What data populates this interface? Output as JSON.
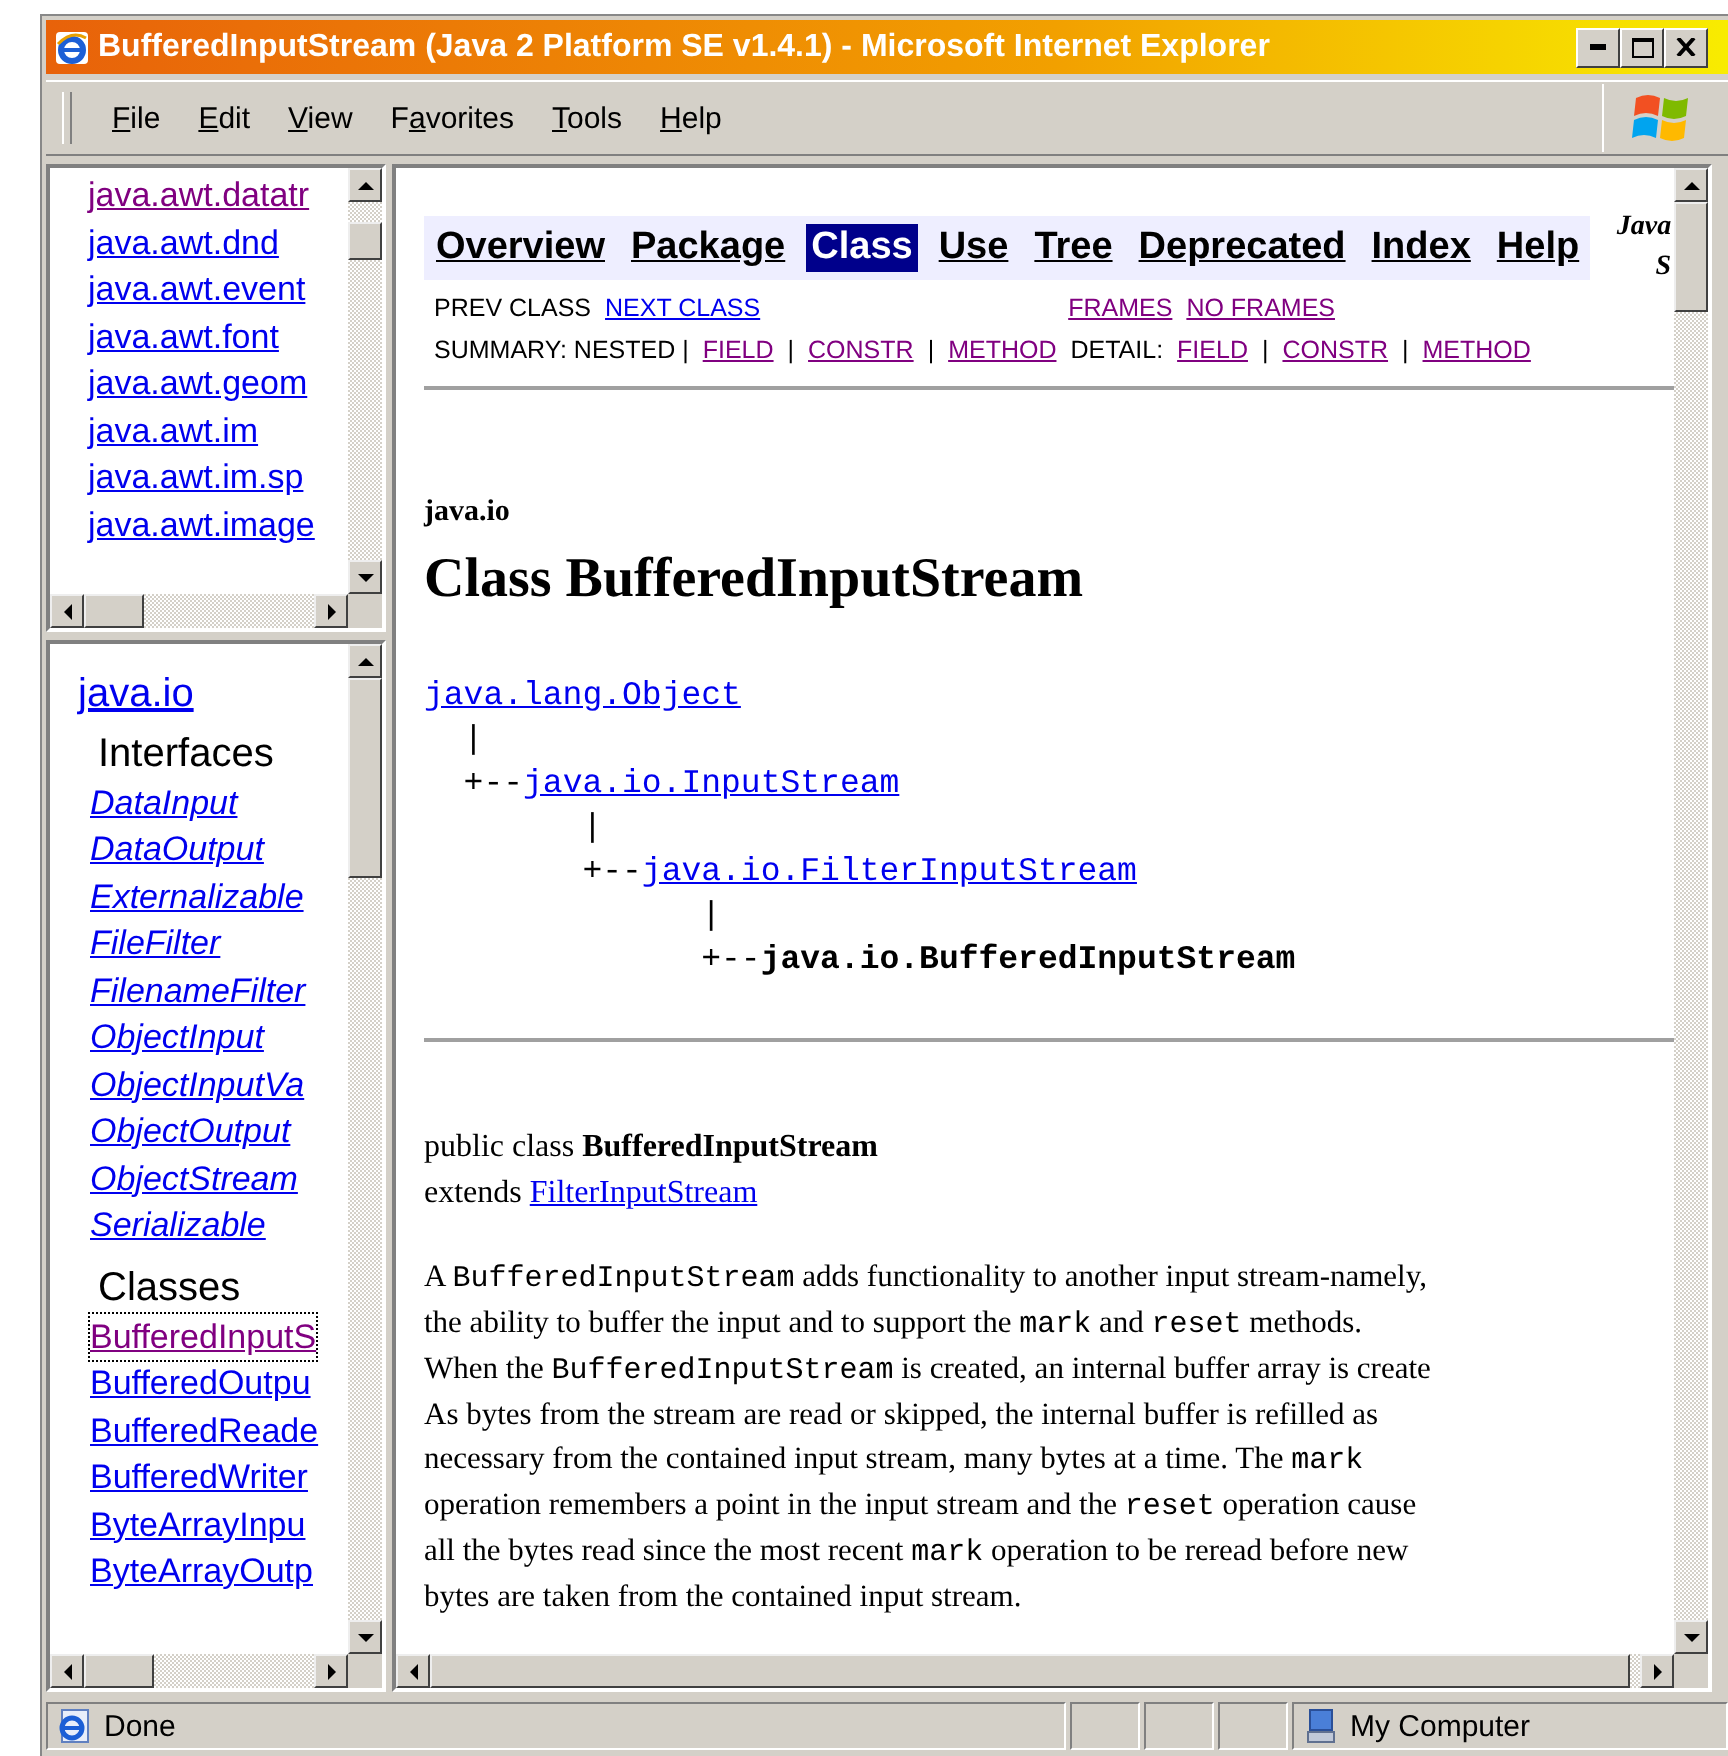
{
  "window": {
    "title": "BufferedInputStream (Java 2 Platform SE v1.4.1) - Microsoft Internet Explorer"
  },
  "menu": [
    {
      "access_key": "F",
      "rest": "ile"
    },
    {
      "access_key": "E",
      "rest": "dit"
    },
    {
      "access_key": "V",
      "rest": "iew"
    },
    {
      "before": "F",
      "access_key": "a",
      "rest": "vorites"
    },
    {
      "access_key": "T",
      "rest": "ools"
    },
    {
      "access_key": "H",
      "rest": "elp"
    }
  ],
  "package_list": [
    {
      "text": "java.awt.datatr",
      "visited": true
    },
    {
      "text": "java.awt.dnd",
      "visited": false
    },
    {
      "text": "java.awt.event",
      "visited": false
    },
    {
      "text": "java.awt.font",
      "visited": false
    },
    {
      "text": "java.awt.geom",
      "visited": false
    },
    {
      "text": "java.awt.im",
      "visited": false
    },
    {
      "text": "java.awt.im.sp",
      "visited": false
    },
    {
      "text": "java.awt.image",
      "visited": false
    }
  ],
  "class_list": {
    "package": "java.io",
    "sections": [
      {
        "heading": "Interfaces",
        "kind": "interface",
        "items": [
          {
            "text": "DataInput",
            "visited": false,
            "focused": false
          },
          {
            "text": "DataOutput",
            "visited": false,
            "focused": false
          },
          {
            "text": "Externalizable",
            "visited": false,
            "focused": false
          },
          {
            "text": "FileFilter",
            "visited": false,
            "focused": false
          },
          {
            "text": "FilenameFilter",
            "visited": false,
            "focused": false
          },
          {
            "text": "ObjectInput",
            "visited": false,
            "focused": false
          },
          {
            "text": "ObjectInputVa",
            "visited": false,
            "focused": false
          },
          {
            "text": "ObjectOutput",
            "visited": false,
            "focused": false
          },
          {
            "text": "ObjectStream",
            "visited": false,
            "focused": false
          },
          {
            "text": "Serializable",
            "visited": false,
            "focused": false
          }
        ]
      },
      {
        "heading": "Classes",
        "kind": "class",
        "items": [
          {
            "text": "BufferedInputS",
            "visited": true,
            "focused": true
          },
          {
            "text": "BufferedOutpu",
            "visited": false,
            "focused": false
          },
          {
            "text": "BufferedReade",
            "visited": false,
            "focused": false
          },
          {
            "text": "BufferedWriter",
            "visited": false,
            "focused": false
          },
          {
            "text": "ByteArrayInpu",
            "visited": false,
            "focused": false
          },
          {
            "text": "ByteArrayOutp",
            "visited": false,
            "focused": false
          }
        ]
      }
    ]
  },
  "nav": {
    "items": [
      {
        "label": "Overview",
        "selected": false
      },
      {
        "label": "Package",
        "selected": false
      },
      {
        "label": "Class",
        "selected": true
      },
      {
        "label": "Use",
        "selected": false
      },
      {
        "label": "Tree",
        "selected": false
      },
      {
        "label": "Deprecated",
        "selected": false
      },
      {
        "label": "Index",
        "selected": false
      },
      {
        "label": "Help",
        "selected": false
      }
    ],
    "side_label": [
      "Java",
      "S"
    ],
    "class_links": [
      {
        "kind": "text",
        "text": "PREV CLASS"
      },
      {
        "kind": "link",
        "text": "NEXT CLASS",
        "visited": false
      },
      {
        "kind": "gap"
      },
      {
        "kind": "link",
        "text": "FRAMES",
        "visited": true
      },
      {
        "kind": "link",
        "text": "NO FRAMES",
        "visited": true
      }
    ],
    "section_links": [
      {
        "kind": "text",
        "text": "SUMMARY: NESTED |"
      },
      {
        "kind": "link",
        "text": "FIELD",
        "visited": true
      },
      {
        "kind": "text",
        "text": "|"
      },
      {
        "kind": "link",
        "text": "CONSTR",
        "visited": true
      },
      {
        "kind": "text",
        "text": "|"
      },
      {
        "kind": "link",
        "text": "METHOD",
        "visited": true
      },
      {
        "kind": "text",
        "text": "DETAIL:"
      },
      {
        "kind": "link",
        "text": "FIELD",
        "visited": true
      },
      {
        "kind": "text",
        "text": "|"
      },
      {
        "kind": "link",
        "text": "CONSTR",
        "visited": true
      },
      {
        "kind": "text",
        "text": "|"
      },
      {
        "kind": "link",
        "text": "METHOD",
        "visited": true
      }
    ]
  },
  "class_header": {
    "package": "java.io",
    "title": "Class BufferedInputStream"
  },
  "hierarchy": [
    {
      "kind": "link",
      "text": "java.lang.Object"
    },
    {
      "kind": "bar",
      "text": "  |"
    },
    {
      "kind": "link",
      "prefix": "  +--",
      "text": "java.io.InputStream"
    },
    {
      "kind": "bar",
      "text": "        |"
    },
    {
      "kind": "link",
      "prefix": "        +--",
      "text": "java.io.FilterInputStream"
    },
    {
      "kind": "bar",
      "text": "              |"
    },
    {
      "kind": "current",
      "prefix": "              +--",
      "text": "java.io.BufferedInputStream"
    }
  ],
  "declaration": {
    "signature": "public class **BufferedInputStream**",
    "extends_label": "extends",
    "extends_link": "FilterInputStream"
  },
  "description": [
    [
      {
        "kind": "text",
        "text": "A "
      },
      {
        "kind": "code",
        "text": "BufferedInputStream"
      },
      {
        "kind": "text",
        "text": " adds functionality to another input stream-namely,"
      }
    ],
    [
      {
        "kind": "text",
        "text": "the ability to buffer the input and to support the "
      },
      {
        "kind": "code",
        "text": "mark"
      },
      {
        "kind": "text",
        "text": " and "
      },
      {
        "kind": "code",
        "text": "reset"
      },
      {
        "kind": "text",
        "text": " methods."
      }
    ],
    [
      {
        "kind": "text",
        "text": "When the "
      },
      {
        "kind": "code",
        "text": "BufferedInputStream"
      },
      {
        "kind": "text",
        "text": " is created, an internal buffer array is create"
      }
    ],
    [
      {
        "kind": "text",
        "text": "As bytes from the stream are read or skipped, the internal buffer is refilled as"
      }
    ],
    [
      {
        "kind": "text",
        "text": "necessary from the contained input stream, many bytes at a time. The "
      },
      {
        "kind": "code",
        "text": "mark"
      }
    ],
    [
      {
        "kind": "text",
        "text": "operation remembers a point in the input stream and the "
      },
      {
        "kind": "code",
        "text": "reset"
      },
      {
        "kind": "text",
        "text": " operation cause"
      }
    ],
    [
      {
        "kind": "text",
        "text": "all the bytes read since the most recent "
      },
      {
        "kind": "code",
        "text": "mark"
      },
      {
        "kind": "text",
        "text": " operation to be reread before new"
      }
    ],
    [
      {
        "kind": "text",
        "text": "bytes are taken from the contained input stream."
      }
    ]
  ],
  "status_bar": {
    "text": "Done",
    "zone": "My Computer"
  }
}
